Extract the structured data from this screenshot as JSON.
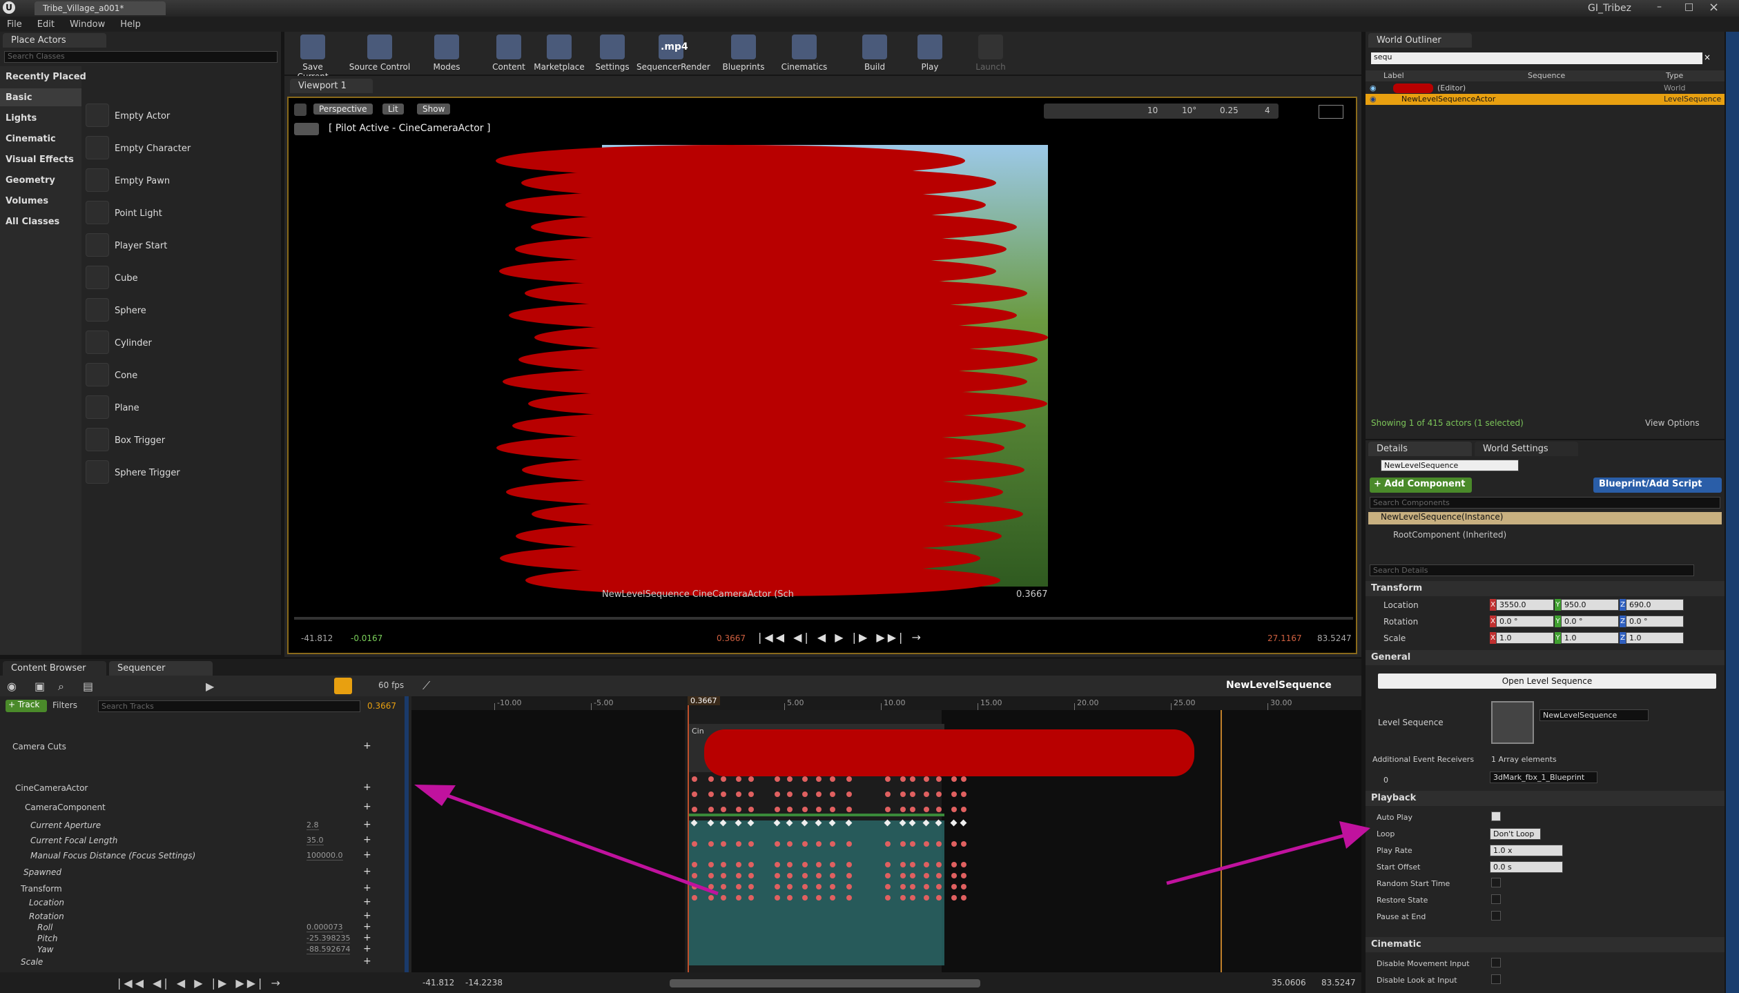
{
  "window": {
    "title": "Tribe_Village_a001*",
    "user": "GI_Tribez"
  },
  "menu": [
    "File",
    "Edit",
    "Window",
    "Help"
  ],
  "place_actors": {
    "tab": "Place Actors",
    "search_placeholder": "Search Classes",
    "categories": [
      "Recently Placed",
      "Basic",
      "Lights",
      "Cinematic",
      "Visual Effects",
      "Geometry",
      "Volumes",
      "All Classes"
    ],
    "items": [
      "Empty Actor",
      "Empty Character",
      "Empty Pawn",
      "Point Light",
      "Player Start",
      "Cube",
      "Sphere",
      "Cylinder",
      "Cone",
      "Plane",
      "Box Trigger",
      "Sphere Trigger"
    ]
  },
  "toolbar": [
    "Save Current",
    "Source Control",
    "Modes",
    "Content",
    "Marketplace",
    "Settings",
    "SequencerRender",
    "Blueprints",
    "Cinematics",
    "Build",
    "Play",
    "Launch"
  ],
  "toolbar_mp4": ".mp4",
  "viewport": {
    "tab": "Viewport 1",
    "perspective": "Perspective",
    "lit": "Lit",
    "show": "Show",
    "pilot": "[ Pilot Active - CineCameraActor ]",
    "snap_grid": "10",
    "snap_angle": "10°",
    "snap_scale": "0.25",
    "cam_speed": "4",
    "overlay_left": "NewLevelSequence  CineCameraActor (Sch",
    "overlay_time": "0.3667",
    "bottom_left": "-41.812",
    "bottom_left2": "-0.0167",
    "bottom_center": "0.3667",
    "bottom_right": "27.1167",
    "bottom_right2": "83.5247"
  },
  "outliner": {
    "tab": "World Outliner",
    "search": "sequ",
    "cols": [
      "Label",
      "Sequence",
      "Type"
    ],
    "rows": [
      {
        "label": "(Editor)",
        "type": "World"
      },
      {
        "label": "NewLevelSequenceActor",
        "type": "LevelSequence"
      }
    ],
    "status": "Showing 1 of 415 actors (1 selected)",
    "view_options": "View Options"
  },
  "details": {
    "tab": "Details",
    "tab2": "World Settings",
    "name": "NewLevelSequence",
    "add_component": "+ Add Component",
    "blueprint": "Blueprint/Add Script",
    "search_components": "Search Components",
    "instance": "NewLevelSequence(Instance)",
    "root": "RootComponent (Inherited)",
    "search_details": "Search Details",
    "transform": "Transform",
    "location": "Location",
    "rotation": "Rotation",
    "scale": "Scale",
    "loc": [
      "3550.0",
      "950.0",
      "690.0"
    ],
    "rot": [
      "0.0 °",
      "0.0 °",
      "0.0 °"
    ],
    "scl": [
      "1.0",
      "1.0",
      "1.0"
    ],
    "general": "General",
    "open_seq": "Open Level Sequence",
    "level_sequence": "Level Sequence",
    "seq_asset": "NewLevelSequence",
    "event_receivers": "Additional Event Receivers",
    "array": "1 Array elements",
    "idx": "0",
    "receiver": "3dMark_fbx_1_Blueprint",
    "playback": "Playback",
    "auto_play": "Auto Play",
    "loop": "Loop",
    "loop_val": "Don't Loop",
    "play_rate": "Play Rate",
    "play_rate_val": "1.0 x",
    "start_offset": "Start Offset",
    "start_offset_val": "0.0 s",
    "random_start": "Random Start Time",
    "restore": "Restore State",
    "pause_end": "Pause at End",
    "cinematic": "Cinematic",
    "disable_move": "Disable Movement Input",
    "disable_look": "Disable Look at Input"
  },
  "bottom_tabs": [
    "Content Browser",
    "Sequencer"
  ],
  "sequencer": {
    "fps": "60 fps",
    "title": "NewLevelSequence",
    "track_btn": "+ Track",
    "filters": "Filters",
    "search_placeholder": "Search Tracks",
    "time": "0.3667",
    "ruler": [
      "-10.00",
      "-5.00",
      "5.00",
      "10.00",
      "15.00",
      "20.00",
      "25.00",
      "30.00"
    ],
    "playhead": "0.3667",
    "tracks": [
      {
        "label": "Camera Cuts"
      },
      {
        "label": "CineCameraActor"
      },
      {
        "label": "CameraComponent"
      },
      {
        "label": "Current Aperture",
        "value": "2.8"
      },
      {
        "label": "Current Focal Length",
        "value": "35.0"
      },
      {
        "label": "Manual Focus Distance (Focus Settings)",
        "value": "100000.0"
      },
      {
        "label": "Spawned"
      },
      {
        "label": "Transform"
      },
      {
        "label": "Location"
      },
      {
        "label": "Rotation"
      },
      {
        "label": "Roll",
        "value": "0.000073"
      },
      {
        "label": "Pitch",
        "value": "-25.398235"
      },
      {
        "label": "Yaw",
        "value": "-88.592674"
      },
      {
        "label": "Scale"
      }
    ],
    "footer_left": "-41.812",
    "footer_left2": "-14.2238",
    "footer_right": "35.0606",
    "footer_right2": "83.5247",
    "cin_label": "Cin"
  }
}
